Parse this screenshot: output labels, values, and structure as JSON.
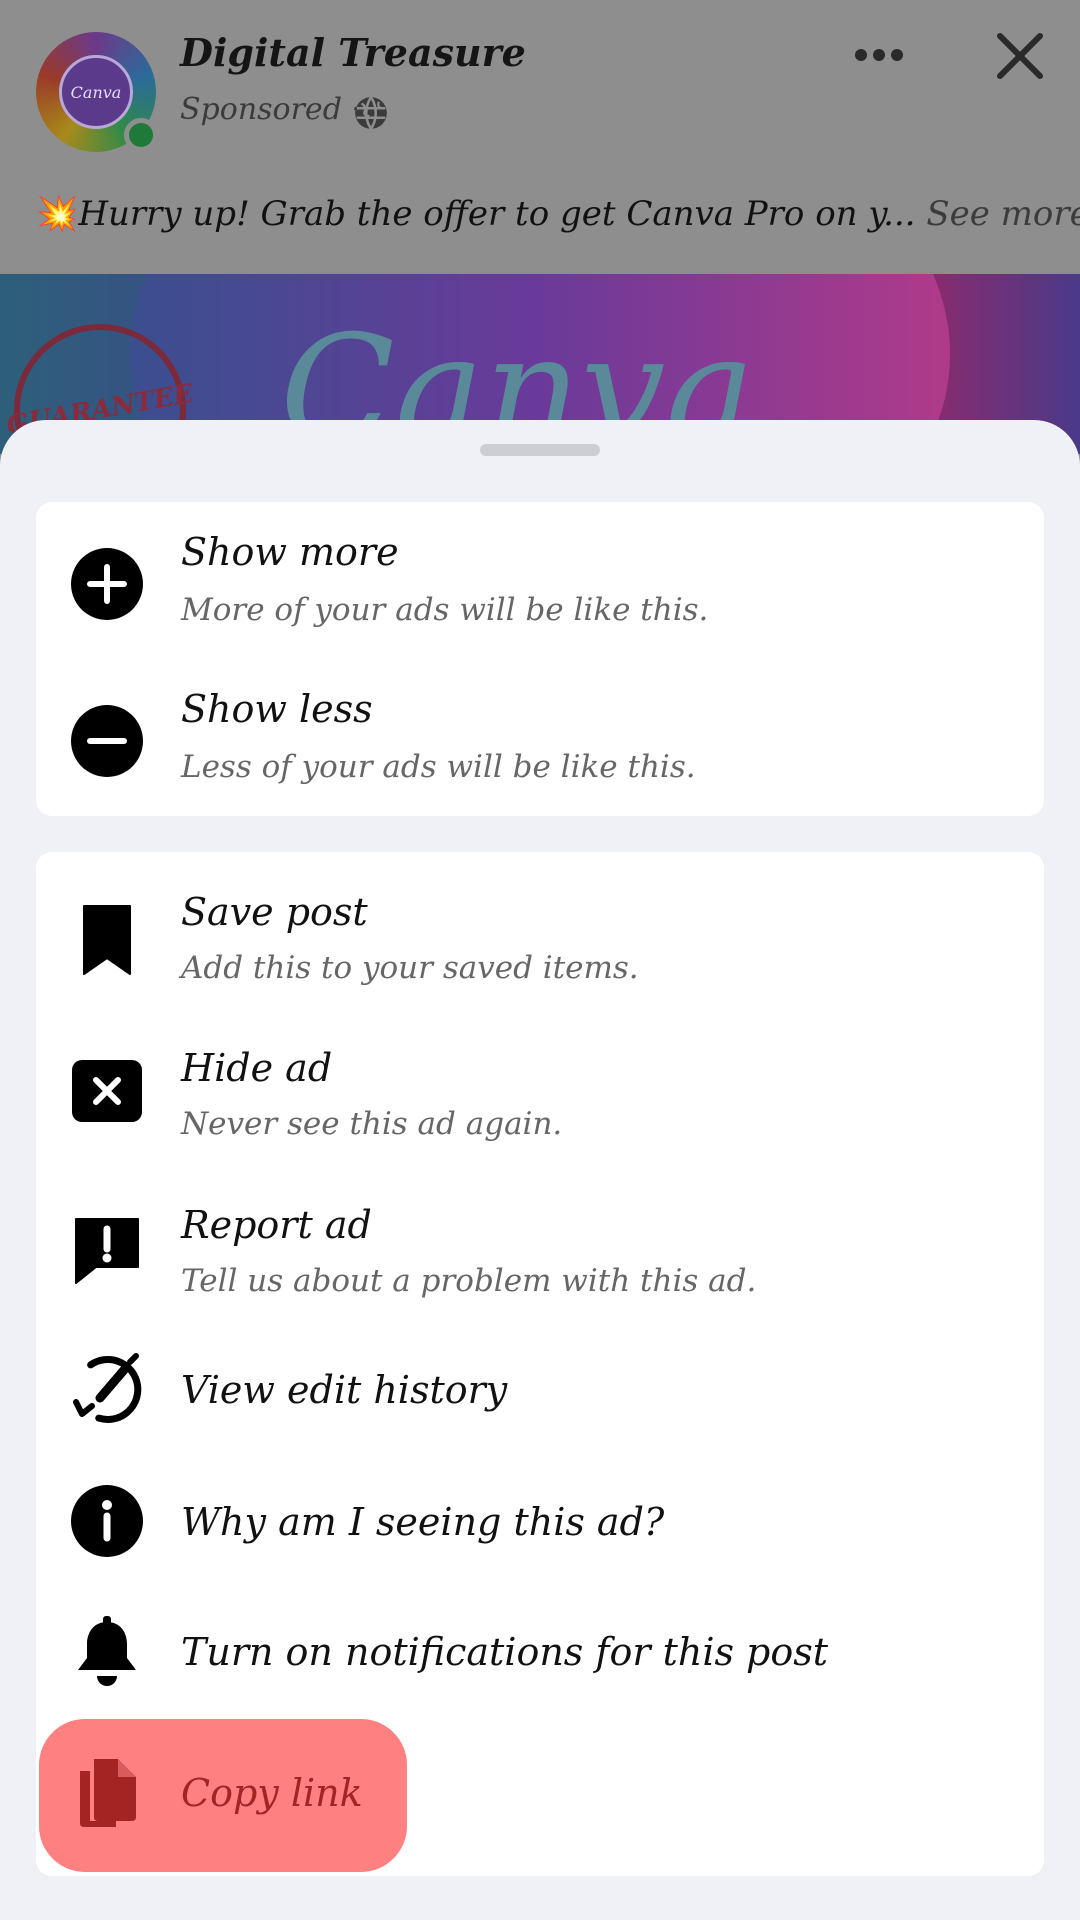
{
  "post": {
    "page_name": "Digital Treasure",
    "sponsored": "Sponsored ·",
    "avatar_text": "Canva",
    "caption_emoji": "💥",
    "caption_text": "Hurry up! Grab the offer to get Canva Pro on y...",
    "see_more": "See more",
    "ad_image_text": "Canva",
    "ad_seal_text": "GUARANTEE"
  },
  "menu": {
    "group1": [
      {
        "title": "Show more",
        "subtitle": "More of your ads will be like this.",
        "icon": "plus-circle-icon"
      },
      {
        "title": "Show less",
        "subtitle": "Less of your ads will be like this.",
        "icon": "minus-circle-icon"
      }
    ],
    "group2": [
      {
        "title": "Save post",
        "subtitle": "Add this to your saved items.",
        "icon": "bookmark-icon"
      },
      {
        "title": "Hide ad",
        "subtitle": "Never see this ad again.",
        "icon": "close-box-icon"
      },
      {
        "title": "Report ad",
        "subtitle": "Tell us about a problem with this ad.",
        "icon": "report-icon"
      },
      {
        "title": "View edit history",
        "icon": "edit-history-icon"
      },
      {
        "title": "Why am I seeing this ad?",
        "icon": "info-icon"
      },
      {
        "title": "Turn on notifications for this post",
        "icon": "bell-icon"
      },
      {
        "title": "Copy link",
        "icon": "copy-icon"
      }
    ]
  },
  "colors": {
    "sheet_bg": "#f0f1f6",
    "card_bg": "#ffffff",
    "overlay": "#8e8e8e",
    "highlight": "#ff8080",
    "highlight_text": "#a42424"
  }
}
